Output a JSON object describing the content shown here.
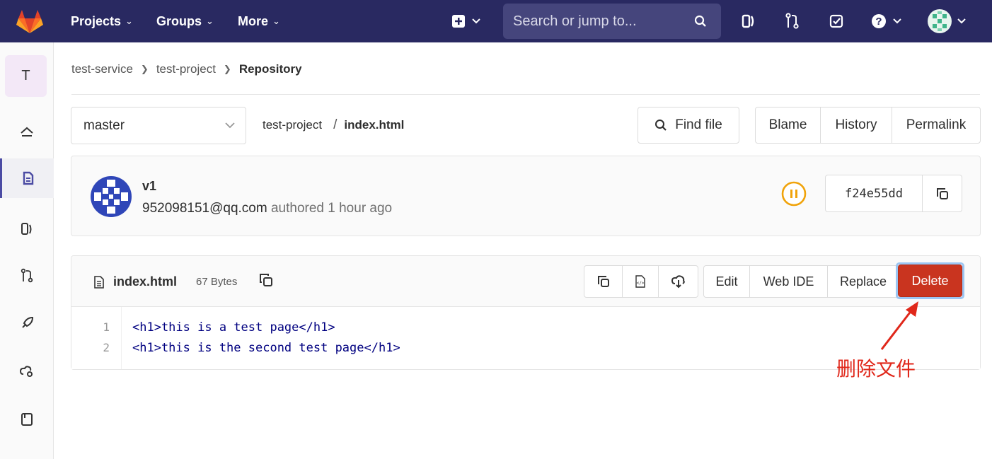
{
  "topnav": {
    "projects_label": "Projects",
    "groups_label": "Groups",
    "more_label": "More",
    "search_placeholder": "Search or jump to..."
  },
  "sidebar": {
    "project_initial": "T"
  },
  "breadcrumb": {
    "items": [
      "test-service",
      "test-project"
    ],
    "current": "Repository"
  },
  "tree": {
    "branch": "master",
    "path_root": "test-project",
    "path_sep": "/",
    "file": "index.html",
    "find_file_label": "Find file",
    "blame_label": "Blame",
    "history_label": "History",
    "permalink_label": "Permalink"
  },
  "commit": {
    "title": "v1",
    "author": "952098151@qq.com",
    "authored_text": "authored 1 hour ago",
    "sha": "f24e55dd",
    "pipeline_status": "paused"
  },
  "file": {
    "name": "index.html",
    "size": "67 Bytes",
    "edit_label": "Edit",
    "webide_label": "Web IDE",
    "replace_label": "Replace",
    "delete_label": "Delete",
    "lines": [
      {
        "num": "1",
        "text": "<h1>this is a test page</h1>"
      },
      {
        "num": "2",
        "text": "<h1>this is the second test page</h1>"
      }
    ]
  },
  "annotation": {
    "text": "删除文件",
    "color": "#e0271a"
  },
  "colors": {
    "navbar": "#292961",
    "delete": "#c9341f",
    "pipeline": "#f0a30a"
  }
}
